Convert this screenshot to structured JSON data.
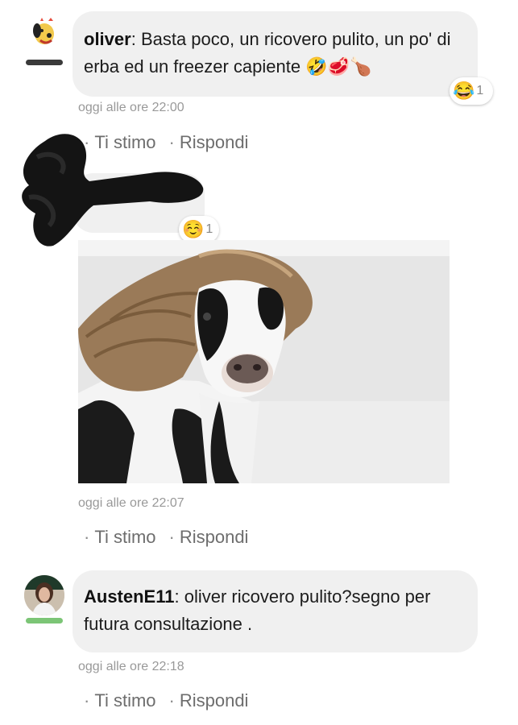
{
  "comments": [
    {
      "author": "oliver",
      "text": "Basta poco, un ricovero pulito, un po' di erba ed un freezer capiente 🤣🥩🍗",
      "reaction": {
        "emoji": "😂",
        "count": "1"
      },
      "timestamp": "oggi alle ore 22:00",
      "actions": {
        "like": "Ti stimo",
        "reply": "Rispondi"
      },
      "status_color": "#3a3a3a"
    },
    {
      "author": "",
      "text": "",
      "reaction": {
        "emoji": "☺️",
        "count": "1"
      },
      "timestamp": "oggi alle ore 22:07",
      "actions": {
        "like": "Ti stimo",
        "reply": "Rispondi"
      }
    },
    {
      "author": "AustenE11",
      "text": "oliver ricovero pulito?segno per futura consultazione .",
      "timestamp": "oggi alle ore 22:18",
      "actions": {
        "like": "Ti stimo",
        "reply": "Rispondi"
      },
      "status_color": "#7cc576"
    }
  ],
  "top_actions": {
    "like": "Ti stimo",
    "reply": "Rispondi"
  },
  "image": {
    "icon": "cow-with-long-hair-image"
  }
}
